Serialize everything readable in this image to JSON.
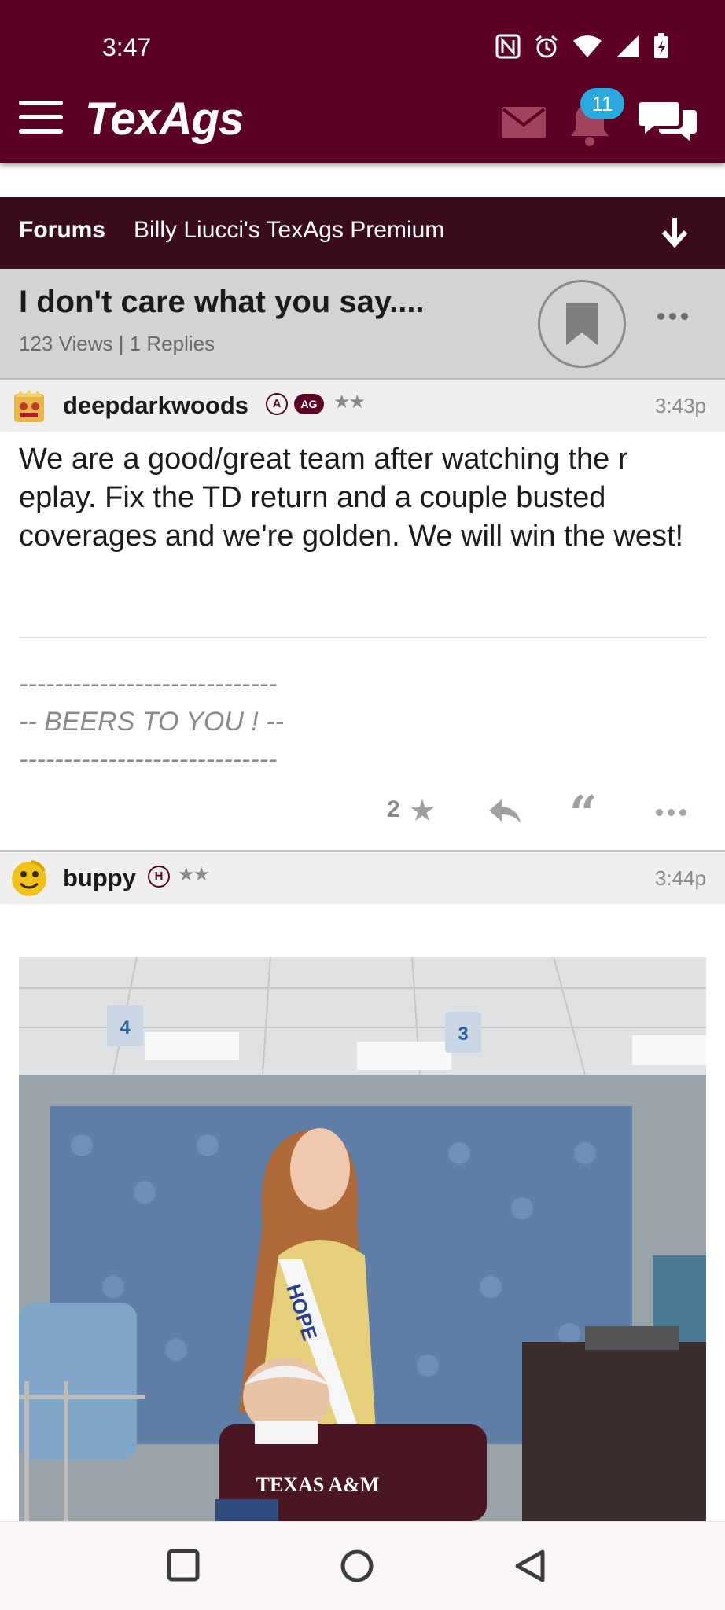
{
  "status_bar": {
    "time": "3:47",
    "icons": [
      "nfc-icon",
      "alarm-icon",
      "wifi-icon",
      "signal-icon",
      "battery-charging-icon"
    ]
  },
  "header": {
    "app_name": "TexAgs",
    "notification_count": "11",
    "colors": {
      "brand": "#5d0025",
      "badge": "#2aa9de"
    }
  },
  "forum_bar": {
    "label": "Forums",
    "forum_name": "Billy Liucci's TexAgs Premium"
  },
  "thread": {
    "title": "I don't care what you say....",
    "meta": "123 Views | 1 Replies"
  },
  "posts": [
    {
      "username": "deepdarkwoods",
      "badges": [
        "A",
        "AG"
      ],
      "rank": "★★",
      "time": "3:43p",
      "body": "We are a good/great team after watching the r eplay. Fix the TD return and a couple busted coverages and we're golden. We will win the west!",
      "signature": "-----------------------------\n-- BEERS TO YOU ! --\n-----------------------------",
      "likes": "2"
    },
    {
      "username": "buppy",
      "badges": [
        "H"
      ],
      "rank": "★★",
      "time": "3:44p",
      "image_text": {
        "sash": "HOPE",
        "shirt": "TEXAS A&M",
        "room_sign_left": "4",
        "room_sign_right": "3"
      }
    }
  ]
}
